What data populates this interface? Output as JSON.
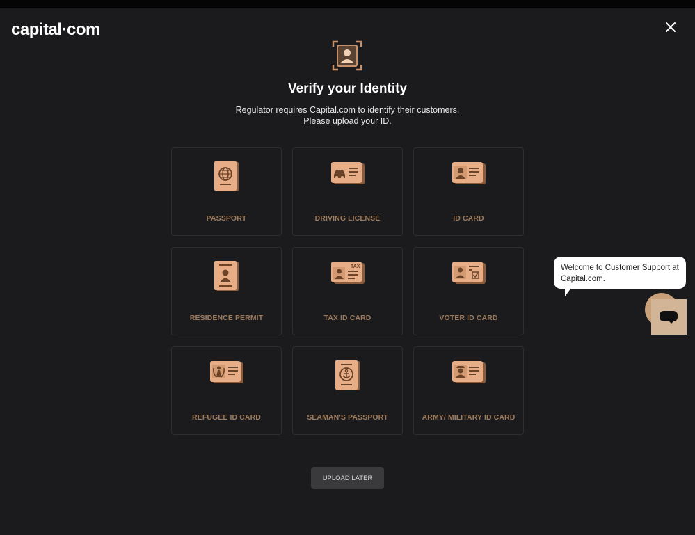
{
  "brand": {
    "logo_text": "capital·com"
  },
  "header": {
    "close_icon": "close-icon"
  },
  "verify": {
    "icon": "user-id-frame-icon",
    "title": "Verify your Identity",
    "subtitle_line1": "Regulator requires Capital.com to identify their customers.",
    "subtitle_line2": "Please upload your ID."
  },
  "documents": [
    {
      "label": "PASSPORT",
      "icon": "passport-globe-icon"
    },
    {
      "label": "DRIVING LICENSE",
      "icon": "driving-license-car-icon"
    },
    {
      "label": "ID CARD",
      "icon": "id-card-person-icon"
    },
    {
      "label": "RESIDENCE PERMIT",
      "icon": "residence-permit-icon"
    },
    {
      "label": "TAX ID CARD",
      "icon": "tax-id-card-icon"
    },
    {
      "label": "VOTER ID CARD",
      "icon": "voter-id-card-icon"
    },
    {
      "label": "REFUGEE ID CARD",
      "icon": "refugee-id-card-icon"
    },
    {
      "label": "SEAMAN'S PASSPORT",
      "icon": "seaman-passport-anchor-icon"
    },
    {
      "label": "ARMY/ MILITARY ID CARD",
      "icon": "military-id-card-icon"
    }
  ],
  "actions": {
    "upload_later": "UPLOAD LATER"
  },
  "chat": {
    "message": "Welcome to Customer Support at Capital.com.",
    "button_icon": "chat-icon"
  },
  "colors": {
    "background": "#1b1b1d",
    "accent": "#c8916a",
    "label": "#9c7a5c",
    "card_border": "#2e2e31"
  }
}
